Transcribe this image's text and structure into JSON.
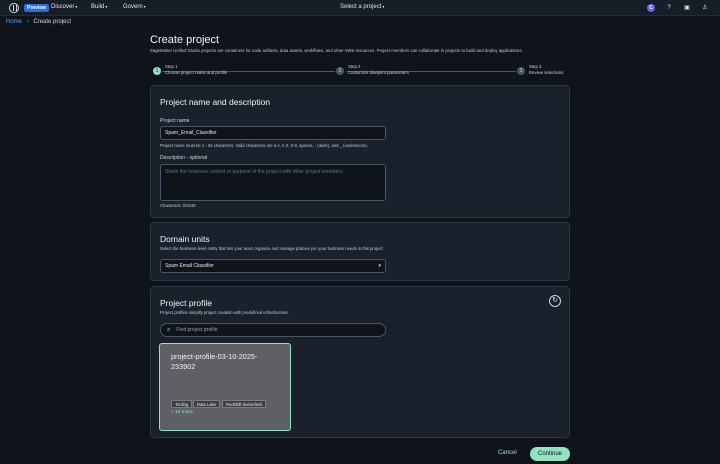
{
  "topbar": {
    "preview_badge": "Preview",
    "nav": [
      "Discover",
      "Build",
      "Govern"
    ],
    "project_selector": "Select a project",
    "avatar_letter": "C"
  },
  "breadcrumb": {
    "home": "Home",
    "current": "Create project"
  },
  "page": {
    "title": "Create project",
    "description": "SageMaker Unified Studio projects are containers for code artifacts, data assets, workflows, and other AWS resources. Project members can collaborate in projects to build and deploy applications."
  },
  "steps": [
    {
      "number": "1",
      "step_label": "Step 1",
      "title": "Choose project name and profile",
      "state": "active"
    },
    {
      "number": "2",
      "step_label": "Step 2",
      "title": "Customize blueprint parameters",
      "state": "inactive"
    },
    {
      "number": "3",
      "step_label": "Step 3",
      "title": "Review selections",
      "state": "inactive"
    }
  ],
  "name_section": {
    "title": "Project name and description",
    "name_label": "Project name",
    "name_value": "Spam_Email_Classifier",
    "name_hint": "Project name must be 1 - 64 characters. Valid characters are a-z, A-Z, 0-9, spaces, - (dash), and _ (underscore).",
    "desc_label": "Description",
    "desc_optional": "optional",
    "desc_placeholder": "Share the business context or purpose of the project with other project members.",
    "char_count": "Characters: 0/2048"
  },
  "domain_section": {
    "title": "Domain units",
    "description": "Select the business-level entity that lets your team organize and manage policies per your business needs in this project.",
    "selected": "Spam Email Classifier"
  },
  "profile_section": {
    "title": "Project profile",
    "description": "Project profiles simplify project creation with predefined infrastructure.",
    "search_placeholder": "Find project profile",
    "profiles": [
      {
        "name": "project-profile-03-10-2025-233902",
        "tags": [
          "Tooling",
          "Data Lake",
          "Redshift Serverless"
        ],
        "more": "+ 12 more"
      }
    ]
  },
  "footer": {
    "cancel": "Cancel",
    "continue": "Continue"
  },
  "colors": {
    "accent": "#8fe3c3",
    "link": "#4ea7ff",
    "background": "#0f141a",
    "card": "#1a212c"
  }
}
